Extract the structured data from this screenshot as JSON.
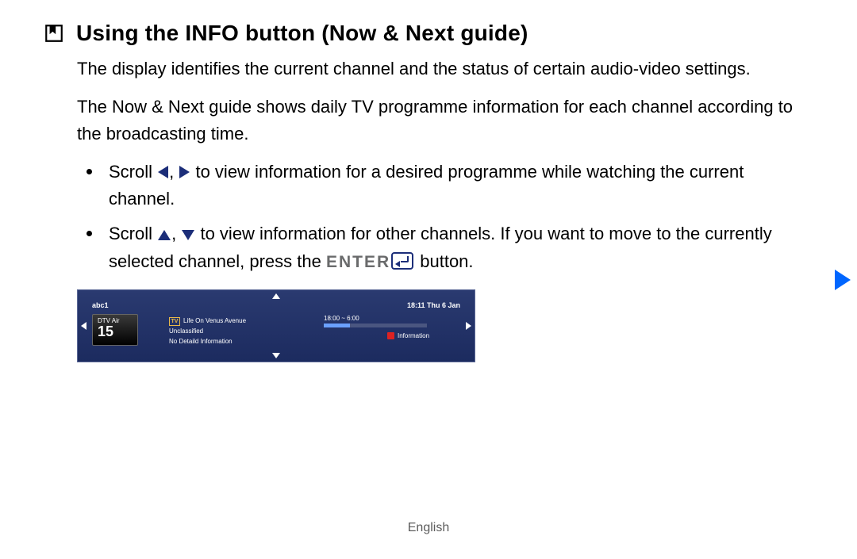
{
  "heading": "Using the INFO button (Now & Next guide)",
  "para1": "The display identifies the current channel and the status of certain audio-video settings.",
  "para2": "The Now & Next guide shows daily TV programme information for each channel according to the broadcasting time.",
  "bullet1_a": "Scroll ",
  "bullet1_b": " to view information for a desired programme while watching the current channel.",
  "bullet2_a": "Scroll ",
  "bullet2_b": " to view information for other channels. If you want to move to the currently selected channel, press the ",
  "bullet2_enter": "ENTER",
  "bullet2_c": " button.",
  "comma": ", ",
  "osd": {
    "channel_name": "abc1",
    "datetime": "18:11 Thu 6 Jan",
    "source": "DTV Air",
    "channel_number": "15",
    "programme_title": "Life On Venus Avenue",
    "rating": "Unclassified",
    "detail": "No Detaild Information",
    "time_range": "18:00 ~ 6:00",
    "info_label": "Information"
  },
  "footer_lang": "English"
}
